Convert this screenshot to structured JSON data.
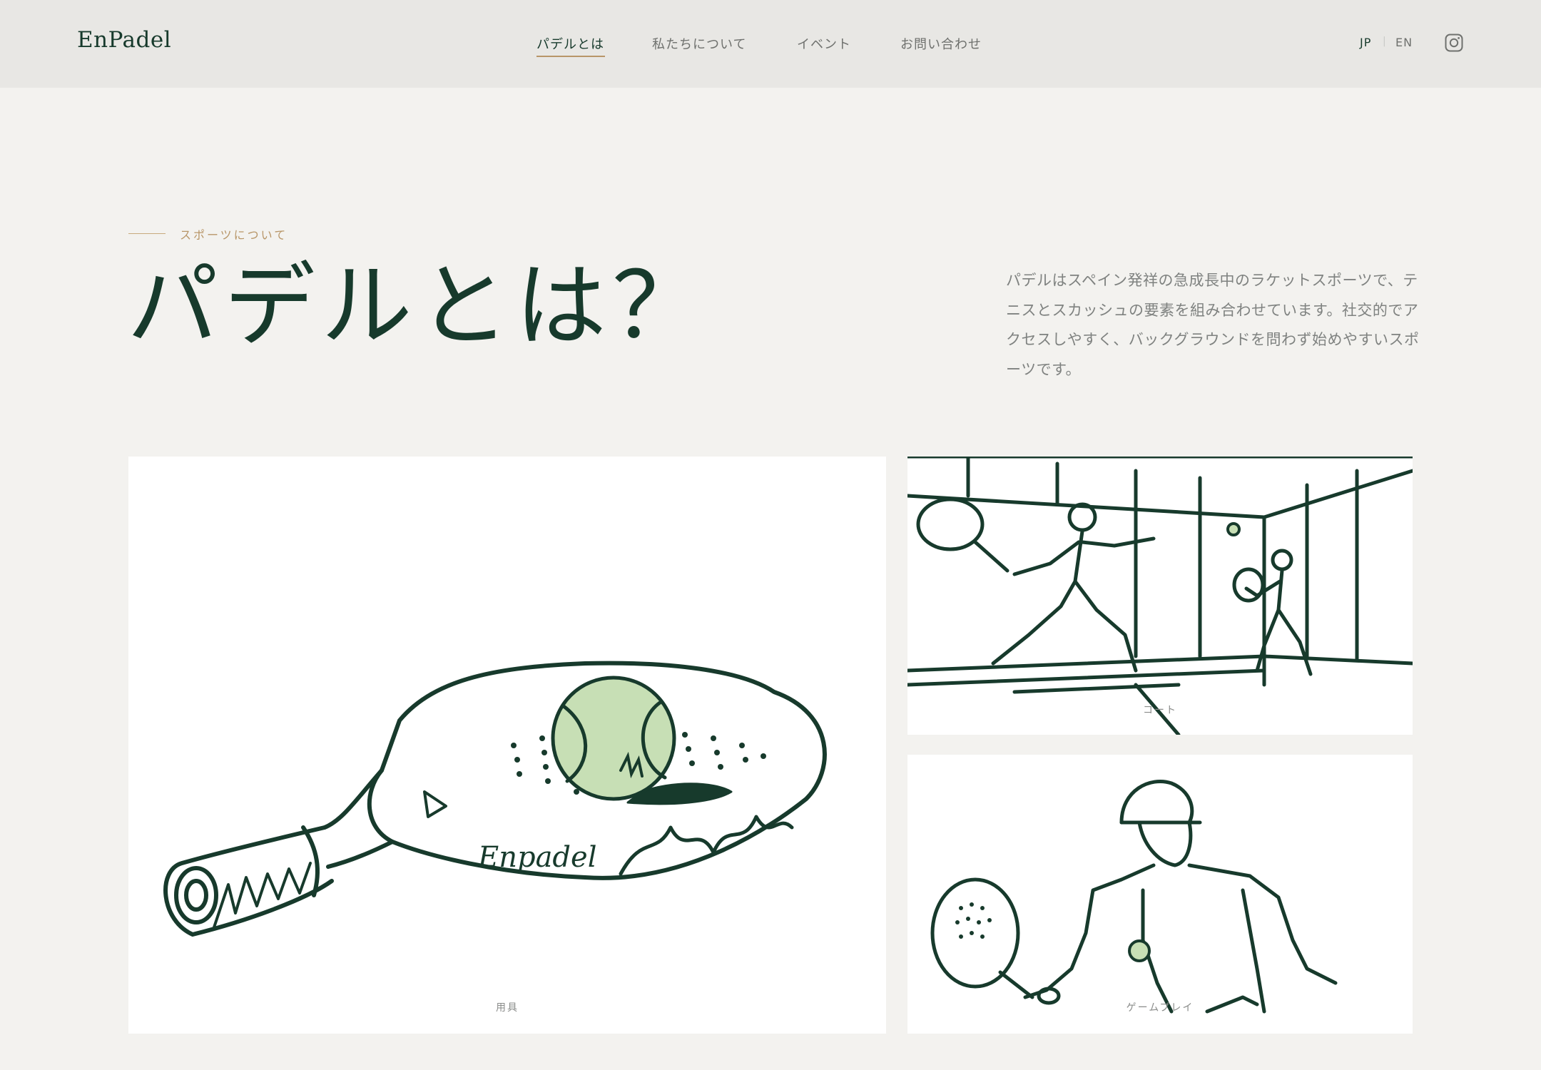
{
  "brand": {
    "logo": "EnPadel"
  },
  "nav": {
    "items": [
      {
        "label": "パデルとは",
        "active": true
      },
      {
        "label": "私たちについて",
        "active": false
      },
      {
        "label": "イベント",
        "active": false
      },
      {
        "label": "お問い合わせ",
        "active": false
      }
    ]
  },
  "lang": {
    "jp": "JP",
    "separator": "|",
    "en": "EN",
    "active": "JP"
  },
  "social": {
    "icon": "instagram-icon"
  },
  "hero": {
    "eyebrow": "スポーツについて",
    "title": "パデルとは？",
    "description": "パデルはスペイン発祥の急成長中のラケットスポーツで、テニスとスカッシュの要素を組み合わせています。社交的でアクセスしやすく、バックグラウンドを問わず始めやすいスポーツです。"
  },
  "gallery": [
    {
      "caption": "用具"
    },
    {
      "caption": "コート"
    },
    {
      "caption": "ゲームプレイ"
    }
  ],
  "colors": {
    "ink": "#173a2c",
    "accent": "#b89668",
    "ball": "#c7dfb5",
    "background": "#f3f2ef",
    "header": "#e8e7e4"
  }
}
